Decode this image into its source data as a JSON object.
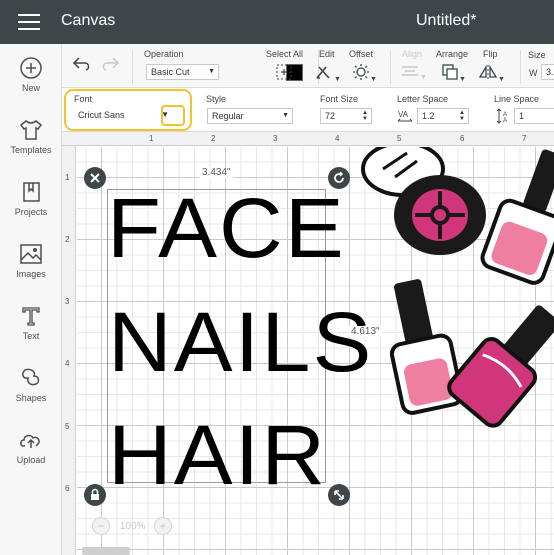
{
  "header": {
    "app_title": "Canvas",
    "doc_title": "Untitled*"
  },
  "sidebar": {
    "items": [
      {
        "label": "New",
        "icon": "plus-circle-icon"
      },
      {
        "label": "Templates",
        "icon": "tshirt-icon"
      },
      {
        "label": "Projects",
        "icon": "bookmark-icon"
      },
      {
        "label": "Images",
        "icon": "image-icon"
      },
      {
        "label": "Text",
        "icon": "text-t-icon"
      },
      {
        "label": "Shapes",
        "icon": "shapes-icon"
      },
      {
        "label": "Upload",
        "icon": "cloud-upload-icon"
      }
    ]
  },
  "toolbar": {
    "operation_label": "Operation",
    "operation_value": "Basic Cut",
    "select_all_label": "Select All",
    "edit_label": "Edit",
    "offset_label": "Offset",
    "align_label": "Align",
    "arrange_label": "Arrange",
    "flip_label": "Flip",
    "size_label": "Size",
    "size_w_label": "W",
    "size_w_value": "3.",
    "swatch_color": "#000000"
  },
  "text_toolbar": {
    "font_label": "Font",
    "font_value": "Cricut Sans",
    "style_label": "Style",
    "style_value": "Regular",
    "font_size_label": "Font Size",
    "font_size_value": "72",
    "letter_space_label": "Letter Space",
    "letter_space_value": "1.2",
    "line_space_label": "Line Space",
    "line_space_value": "1",
    "highlight_color": "#f2c230"
  },
  "ruler": {
    "top": [
      "1",
      "2",
      "3",
      "4",
      "5",
      "6",
      "7"
    ],
    "left": [
      "1",
      "2",
      "3",
      "4",
      "5",
      "6"
    ]
  },
  "canvas": {
    "words": [
      "FACE",
      "NAILS",
      "HAIR"
    ],
    "width_label": "3.434\"",
    "height_label": "4.613\""
  },
  "zoom": {
    "value": "100%",
    "minus": "−",
    "plus": "+"
  }
}
